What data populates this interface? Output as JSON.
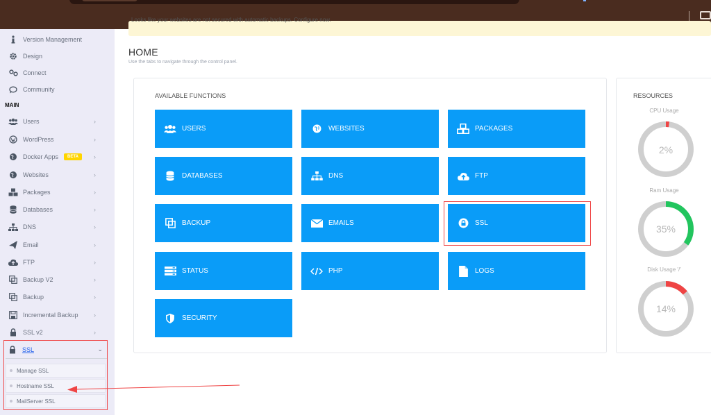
{
  "notice": {
    "text": "Looks like your websites are not secured with automatic backups. Configure now."
  },
  "sidebar": {
    "items_top": [
      {
        "label": "Version Management",
        "icon": "info-icon"
      },
      {
        "label": "Design",
        "icon": "gear-icon"
      },
      {
        "label": "Connect",
        "icon": "link-icon"
      },
      {
        "label": "Community",
        "icon": "chat-icon"
      }
    ],
    "section_main": "MAIN",
    "items_main": [
      {
        "label": "Users",
        "icon": "users-icon"
      },
      {
        "label": "WordPress",
        "icon": "wordpress-icon"
      },
      {
        "label": "Docker Apps",
        "icon": "globe-icon",
        "badge": "BETA"
      },
      {
        "label": "Websites",
        "icon": "globe-icon"
      },
      {
        "label": "Packages",
        "icon": "cubes-icon"
      },
      {
        "label": "Databases",
        "icon": "database-icon"
      },
      {
        "label": "DNS",
        "icon": "sitemap-icon"
      },
      {
        "label": "Email",
        "icon": "paper-plane-icon"
      },
      {
        "label": "FTP",
        "icon": "cloud-upload-icon"
      },
      {
        "label": "Backup V2",
        "icon": "copy-icon"
      },
      {
        "label": "Backup",
        "icon": "copy-icon"
      },
      {
        "label": "Incremental Backup",
        "icon": "save-icon"
      },
      {
        "label": "SSL v2",
        "icon": "lock-icon"
      }
    ],
    "ssl_expanded": {
      "label": "SSL",
      "icon": "lock-icon"
    },
    "ssl_sub": [
      "Manage SSL",
      "Hostname SSL",
      "MailServer SSL"
    ]
  },
  "header": {
    "title": "HOME",
    "subtitle": "Use the tabs to navigate through the control panel."
  },
  "functions": {
    "title": "AVAILABLE FUNCTIONS",
    "buttons": [
      {
        "label": "USERS",
        "icon": "users-icon"
      },
      {
        "label": "WEBSITES",
        "icon": "globe-icon"
      },
      {
        "label": "PACKAGES",
        "icon": "cubes-icon"
      },
      {
        "label": "DATABASES",
        "icon": "database-icon"
      },
      {
        "label": "DNS",
        "icon": "sitemap-icon"
      },
      {
        "label": "FTP",
        "icon": "cloud-upload-icon"
      },
      {
        "label": "BACKUP",
        "icon": "copy-icon"
      },
      {
        "label": "EMAILS",
        "icon": "envelope-icon"
      },
      {
        "label": "SSL",
        "icon": "lock-icon"
      },
      {
        "label": "STATUS",
        "icon": "server-icon"
      },
      {
        "label": "PHP",
        "icon": "code-icon"
      },
      {
        "label": "LOGS",
        "icon": "file-icon"
      },
      {
        "label": "SECURITY",
        "icon": "shield-icon"
      }
    ]
  },
  "resources": {
    "title": "RESOURCES",
    "gauges": [
      {
        "label": "CPU Usage",
        "value": 2,
        "display": "2%"
      },
      {
        "label": "Ram Usage",
        "value": 35,
        "display": "35%"
      },
      {
        "label": "Disk Usage '/'",
        "value": 14,
        "display": "14%"
      }
    ]
  },
  "colors": {
    "accent": "#0a9cf8",
    "gauge_red": "#ef4444",
    "gauge_green": "#22c55e",
    "gauge_track": "#cfcfcf",
    "highlight": "#ef4444"
  }
}
